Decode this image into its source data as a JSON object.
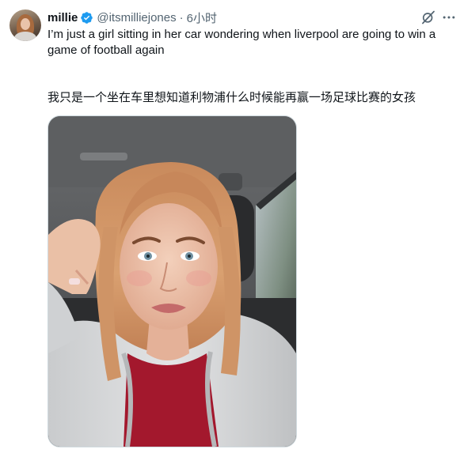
{
  "tweet": {
    "display_name": "millie",
    "handle": "@itsmilliejones",
    "separator": "·",
    "time": "6小时",
    "text": "I’m just a girl sitting in her car wondering when liverpool are going to win a game of football again",
    "translation": "我只是一个坐在车里想知道利物浦什么时候能再赢一场足球比赛的女孩"
  },
  "icons": {
    "verified": "verified-badge-icon",
    "grok": "grok-icon",
    "more": "more-options-icon"
  },
  "colors": {
    "text_primary": "#0f1419",
    "text_secondary": "#536471",
    "verified_blue": "#1d9bf0"
  }
}
